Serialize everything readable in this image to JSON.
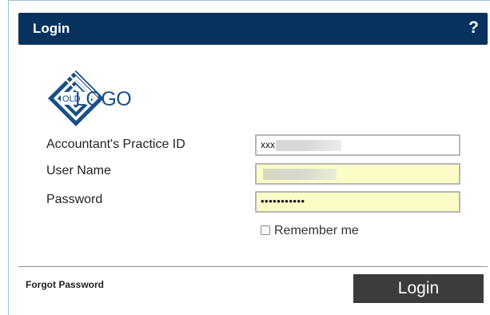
{
  "header": {
    "title": "Login",
    "help_label": "?"
  },
  "logo": {
    "small_text": "OLD",
    "main_text": "LOGO",
    "color": "#1b4f8c"
  },
  "form": {
    "practice_id": {
      "label": "Accountant's Practice ID",
      "value": "xxx"
    },
    "username": {
      "label": "User Name",
      "value": ""
    },
    "password": {
      "label": "Password",
      "masked_value": "•••••••••••"
    },
    "remember": {
      "label": "Remember me",
      "checked": false
    }
  },
  "footer": {
    "forgot_label": "Forgot Password",
    "login_label": "Login"
  },
  "colors": {
    "header_bg": "#08325e",
    "autofill_bg": "#fbfcc6",
    "button_bg": "#3c3c3c"
  }
}
